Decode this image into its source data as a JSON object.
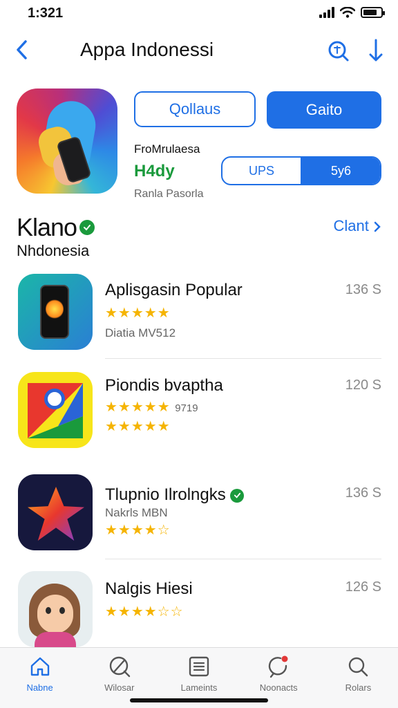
{
  "status": {
    "time": "1:321"
  },
  "nav": {
    "title": "Appa Indonessi"
  },
  "hero": {
    "button_outline": "Qollaus",
    "button_solid": "Gaito",
    "subtitle": "FroMrulaesa",
    "rating": "H4dy",
    "publisher": "Ranla Pasorla",
    "segment_left": "UPS",
    "segment_right": "5y6"
  },
  "section": {
    "title": "Klano",
    "subtitle": "Nhdonesia",
    "link": "Clant"
  },
  "apps": [
    {
      "name": "Aplisgasin Popular",
      "size": "136 S",
      "stars": "★★★★★",
      "meta": "Diatia MV512"
    },
    {
      "name": "Piondis bvaptha",
      "size": "120 S",
      "stars": "★★★★★",
      "stars_label": "9719",
      "stars2": "★★★★★"
    },
    {
      "name": "Tlupnio Ilrolngks",
      "size": "136 S",
      "meta": "Nakrls MBN",
      "stars": "★★★★☆"
    },
    {
      "name": "Nalgis Hiesi",
      "size": "126 S",
      "stars": "★★★★☆☆"
    }
  ],
  "tabbar": {
    "items": [
      {
        "label": "Nabne",
        "icon": "home-icon"
      },
      {
        "label": "Wilosar",
        "icon": "compass-icon"
      },
      {
        "label": "Lameints",
        "icon": "list-icon"
      },
      {
        "label": "Noonacts",
        "icon": "notification-icon"
      },
      {
        "label": "Rolars",
        "icon": "search-icon"
      }
    ],
    "active_index": 0
  },
  "colors": {
    "accent": "#1f6fe5",
    "rating_green": "#1a9a3c",
    "star": "#f5b400"
  }
}
